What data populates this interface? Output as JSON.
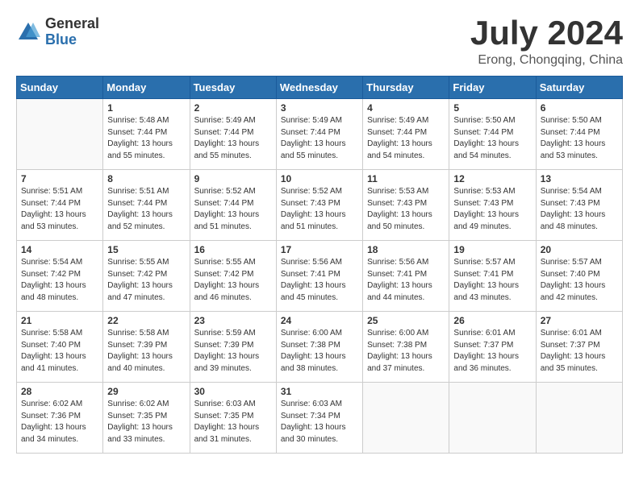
{
  "header": {
    "logo_general": "General",
    "logo_blue": "Blue",
    "month_title": "July 2024",
    "subtitle": "Erong, Chongqing, China"
  },
  "weekdays": [
    "Sunday",
    "Monday",
    "Tuesday",
    "Wednesday",
    "Thursday",
    "Friday",
    "Saturday"
  ],
  "weeks": [
    [
      {
        "day": "",
        "empty": true
      },
      {
        "day": "1",
        "sunrise": "5:48 AM",
        "sunset": "7:44 PM",
        "daylight": "13 hours and 55 minutes."
      },
      {
        "day": "2",
        "sunrise": "5:49 AM",
        "sunset": "7:44 PM",
        "daylight": "13 hours and 55 minutes."
      },
      {
        "day": "3",
        "sunrise": "5:49 AM",
        "sunset": "7:44 PM",
        "daylight": "13 hours and 55 minutes."
      },
      {
        "day": "4",
        "sunrise": "5:49 AM",
        "sunset": "7:44 PM",
        "daylight": "13 hours and 54 minutes."
      },
      {
        "day": "5",
        "sunrise": "5:50 AM",
        "sunset": "7:44 PM",
        "daylight": "13 hours and 54 minutes."
      },
      {
        "day": "6",
        "sunrise": "5:50 AM",
        "sunset": "7:44 PM",
        "daylight": "13 hours and 53 minutes."
      }
    ],
    [
      {
        "day": "7",
        "sunrise": "5:51 AM",
        "sunset": "7:44 PM",
        "daylight": "13 hours and 53 minutes."
      },
      {
        "day": "8",
        "sunrise": "5:51 AM",
        "sunset": "7:44 PM",
        "daylight": "13 hours and 52 minutes."
      },
      {
        "day": "9",
        "sunrise": "5:52 AM",
        "sunset": "7:44 PM",
        "daylight": "13 hours and 51 minutes."
      },
      {
        "day": "10",
        "sunrise": "5:52 AM",
        "sunset": "7:43 PM",
        "daylight": "13 hours and 51 minutes."
      },
      {
        "day": "11",
        "sunrise": "5:53 AM",
        "sunset": "7:43 PM",
        "daylight": "13 hours and 50 minutes."
      },
      {
        "day": "12",
        "sunrise": "5:53 AM",
        "sunset": "7:43 PM",
        "daylight": "13 hours and 49 minutes."
      },
      {
        "day": "13",
        "sunrise": "5:54 AM",
        "sunset": "7:43 PM",
        "daylight": "13 hours and 48 minutes."
      }
    ],
    [
      {
        "day": "14",
        "sunrise": "5:54 AM",
        "sunset": "7:42 PM",
        "daylight": "13 hours and 48 minutes."
      },
      {
        "day": "15",
        "sunrise": "5:55 AM",
        "sunset": "7:42 PM",
        "daylight": "13 hours and 47 minutes."
      },
      {
        "day": "16",
        "sunrise": "5:55 AM",
        "sunset": "7:42 PM",
        "daylight": "13 hours and 46 minutes."
      },
      {
        "day": "17",
        "sunrise": "5:56 AM",
        "sunset": "7:41 PM",
        "daylight": "13 hours and 45 minutes."
      },
      {
        "day": "18",
        "sunrise": "5:56 AM",
        "sunset": "7:41 PM",
        "daylight": "13 hours and 44 minutes."
      },
      {
        "day": "19",
        "sunrise": "5:57 AM",
        "sunset": "7:41 PM",
        "daylight": "13 hours and 43 minutes."
      },
      {
        "day": "20",
        "sunrise": "5:57 AM",
        "sunset": "7:40 PM",
        "daylight": "13 hours and 42 minutes."
      }
    ],
    [
      {
        "day": "21",
        "sunrise": "5:58 AM",
        "sunset": "7:40 PM",
        "daylight": "13 hours and 41 minutes."
      },
      {
        "day": "22",
        "sunrise": "5:58 AM",
        "sunset": "7:39 PM",
        "daylight": "13 hours and 40 minutes."
      },
      {
        "day": "23",
        "sunrise": "5:59 AM",
        "sunset": "7:39 PM",
        "daylight": "13 hours and 39 minutes."
      },
      {
        "day": "24",
        "sunrise": "6:00 AM",
        "sunset": "7:38 PM",
        "daylight": "13 hours and 38 minutes."
      },
      {
        "day": "25",
        "sunrise": "6:00 AM",
        "sunset": "7:38 PM",
        "daylight": "13 hours and 37 minutes."
      },
      {
        "day": "26",
        "sunrise": "6:01 AM",
        "sunset": "7:37 PM",
        "daylight": "13 hours and 36 minutes."
      },
      {
        "day": "27",
        "sunrise": "6:01 AM",
        "sunset": "7:37 PM",
        "daylight": "13 hours and 35 minutes."
      }
    ],
    [
      {
        "day": "28",
        "sunrise": "6:02 AM",
        "sunset": "7:36 PM",
        "daylight": "13 hours and 34 minutes."
      },
      {
        "day": "29",
        "sunrise": "6:02 AM",
        "sunset": "7:35 PM",
        "daylight": "13 hours and 33 minutes."
      },
      {
        "day": "30",
        "sunrise": "6:03 AM",
        "sunset": "7:35 PM",
        "daylight": "13 hours and 31 minutes."
      },
      {
        "day": "31",
        "sunrise": "6:03 AM",
        "sunset": "7:34 PM",
        "daylight": "13 hours and 30 minutes."
      },
      {
        "day": "",
        "empty": true
      },
      {
        "day": "",
        "empty": true
      },
      {
        "day": "",
        "empty": true
      }
    ]
  ]
}
